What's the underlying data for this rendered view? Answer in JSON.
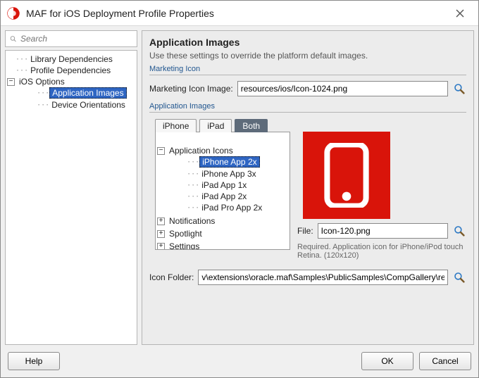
{
  "window": {
    "title": "MAF for iOS Deployment Profile Properties"
  },
  "search": {
    "placeholder": "Search"
  },
  "navTree": {
    "items": {
      "libDeps": "Library Dependencies",
      "profDeps": "Profile Dependencies",
      "iosOptions": "iOS Options",
      "appImages": "Application Images",
      "devOrient": "Device Orientations"
    }
  },
  "main": {
    "heading": "Application Images",
    "description": "Use these settings to override the platform default images.",
    "marketingGroup": "Marketing Icon",
    "marketingLabel": "Marketing Icon Image:",
    "marketingValue": "resources/ios/Icon-1024.png",
    "appImagesGroup": "Application Images",
    "tabs": {
      "iphone": "iPhone",
      "ipad": "iPad",
      "both": "Both"
    },
    "iconTree": {
      "root": "Application Icons",
      "items": {
        "iphone2x": "iPhone App 2x",
        "iphone3x": "iPhone App 3x",
        "ipad1x": "iPad App 1x",
        "ipad2x": "iPad App 2x",
        "ipadpro2x": "iPad Pro App 2x"
      },
      "groups": {
        "notifications": "Notifications",
        "spotlight": "Spotlight",
        "settings": "Settings"
      }
    },
    "fileLabel": "File:",
    "fileValue": "Icon-120.png",
    "note": "Required. Application icon for iPhone/iPod touch Retina. (120x120)",
    "iconFolderLabel": "Icon Folder:",
    "iconFolderValue": "v\\extensions\\oracle.maf\\Samples\\PublicSamples\\CompGallery\\resources\\ios"
  },
  "footer": {
    "help": "Help",
    "ok": "OK",
    "cancel": "Cancel"
  }
}
